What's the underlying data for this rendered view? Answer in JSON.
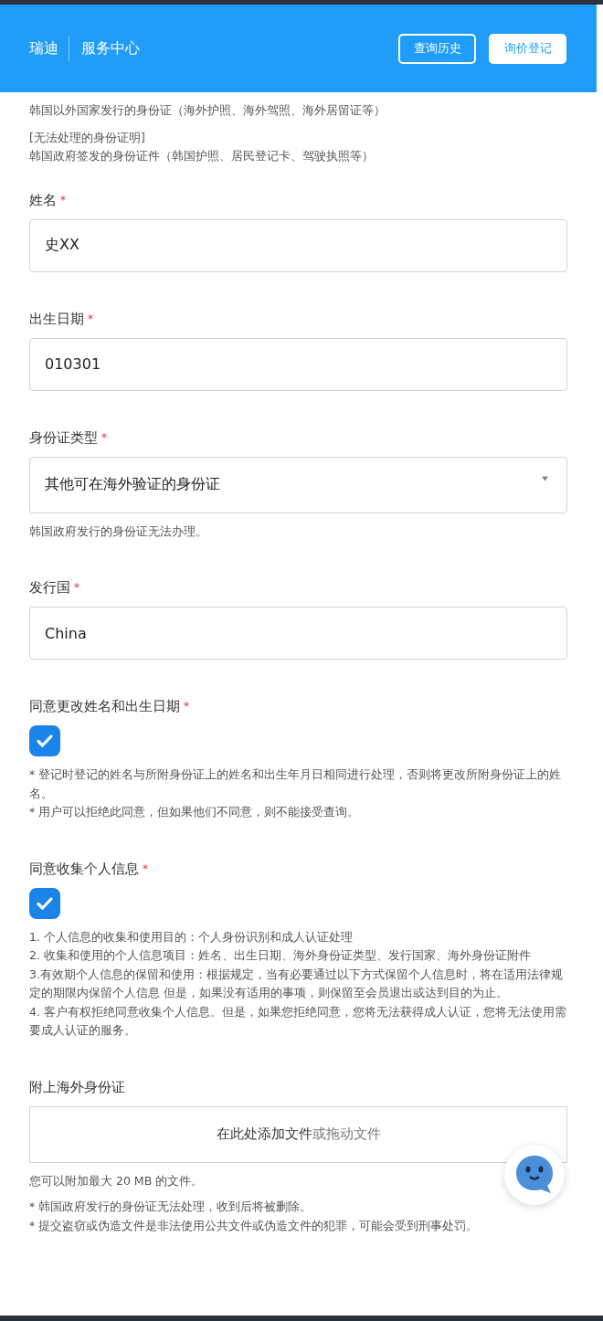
{
  "header": {
    "brand": "瑞迪",
    "section": "服务中心",
    "buttons": [
      {
        "label": "查询历史",
        "kind": "outline"
      },
      {
        "label": "询价登记",
        "kind": "solid"
      }
    ]
  },
  "intro": [
    {
      "lines": [
        "韩国以外国家发行的身份证（海外护照、海外驾照、海外居留证等）"
      ]
    },
    {
      "lines": [
        "[无法处理的身份证明]",
        "韩国政府签发的身份证件（韩国护照、居民登记卡、驾驶执照等）"
      ]
    }
  ],
  "fields": [
    {
      "kind": "text",
      "label": "姓名",
      "required_mark": "*",
      "value": "史XX"
    },
    {
      "kind": "text",
      "label": "出生日期",
      "required_mark": "*",
      "value": "010301"
    },
    {
      "kind": "select",
      "label": "身份证类型",
      "required_mark": "*",
      "value": "其他可在海外验证的身份证",
      "notes": [
        "韩国政府发行的身份证无法办理。"
      ]
    },
    {
      "kind": "text",
      "label": "发行国",
      "required_mark": "*",
      "value": "China"
    },
    {
      "kind": "checkbox",
      "label": "同意更改姓名和出生日期",
      "required_mark": "*",
      "checked": true,
      "notes": [
        "* 登记时登记的姓名与所附身份证上的姓名和出生年月日相同进行处理，否则将更改所附身份证上的姓名。",
        "* 用户可以拒绝此同意，但如果他们不同意，则不能接受查询。"
      ]
    },
    {
      "kind": "checkbox",
      "label": "同意收集个人信息",
      "required_mark": "*",
      "checked": true,
      "notes": [
        "1. 个人信息的收集和使用目的：个人身份识别和成人认证处理",
        "2. 收集和使用的个人信息项目：姓名、出生日期、海外身份证类型、发行国家、海外身份证附件",
        "3.有效期个人信息的保留和使用：根据规定，当有必要通过以下方式保留个人信息时，将在适用法律规定的期限内保留个人信息 但是，如果没有适用的事项，则保留至会员退出或达到目的为止。",
        "4. 客户有权拒绝同意收集个人信息。但是，如果您拒绝同意，您将无法获得成人认证，您将无法使用需要成人认证的服务。"
      ]
    },
    {
      "kind": "upload",
      "label": "附上海外身份证",
      "action": "在此处添加文件",
      "hint": "或拖动文件",
      "size_note": "您可以附加最大 20 MB 的文件。",
      "notes": [
        "* 韩国政府发行的身份证无法处理，收到后将被删除。",
        "* 提交盗窃或伪造文件是非法使用公共文件或伪造文件的犯罪，可能会受到刑事处罚。"
      ]
    }
  ]
}
